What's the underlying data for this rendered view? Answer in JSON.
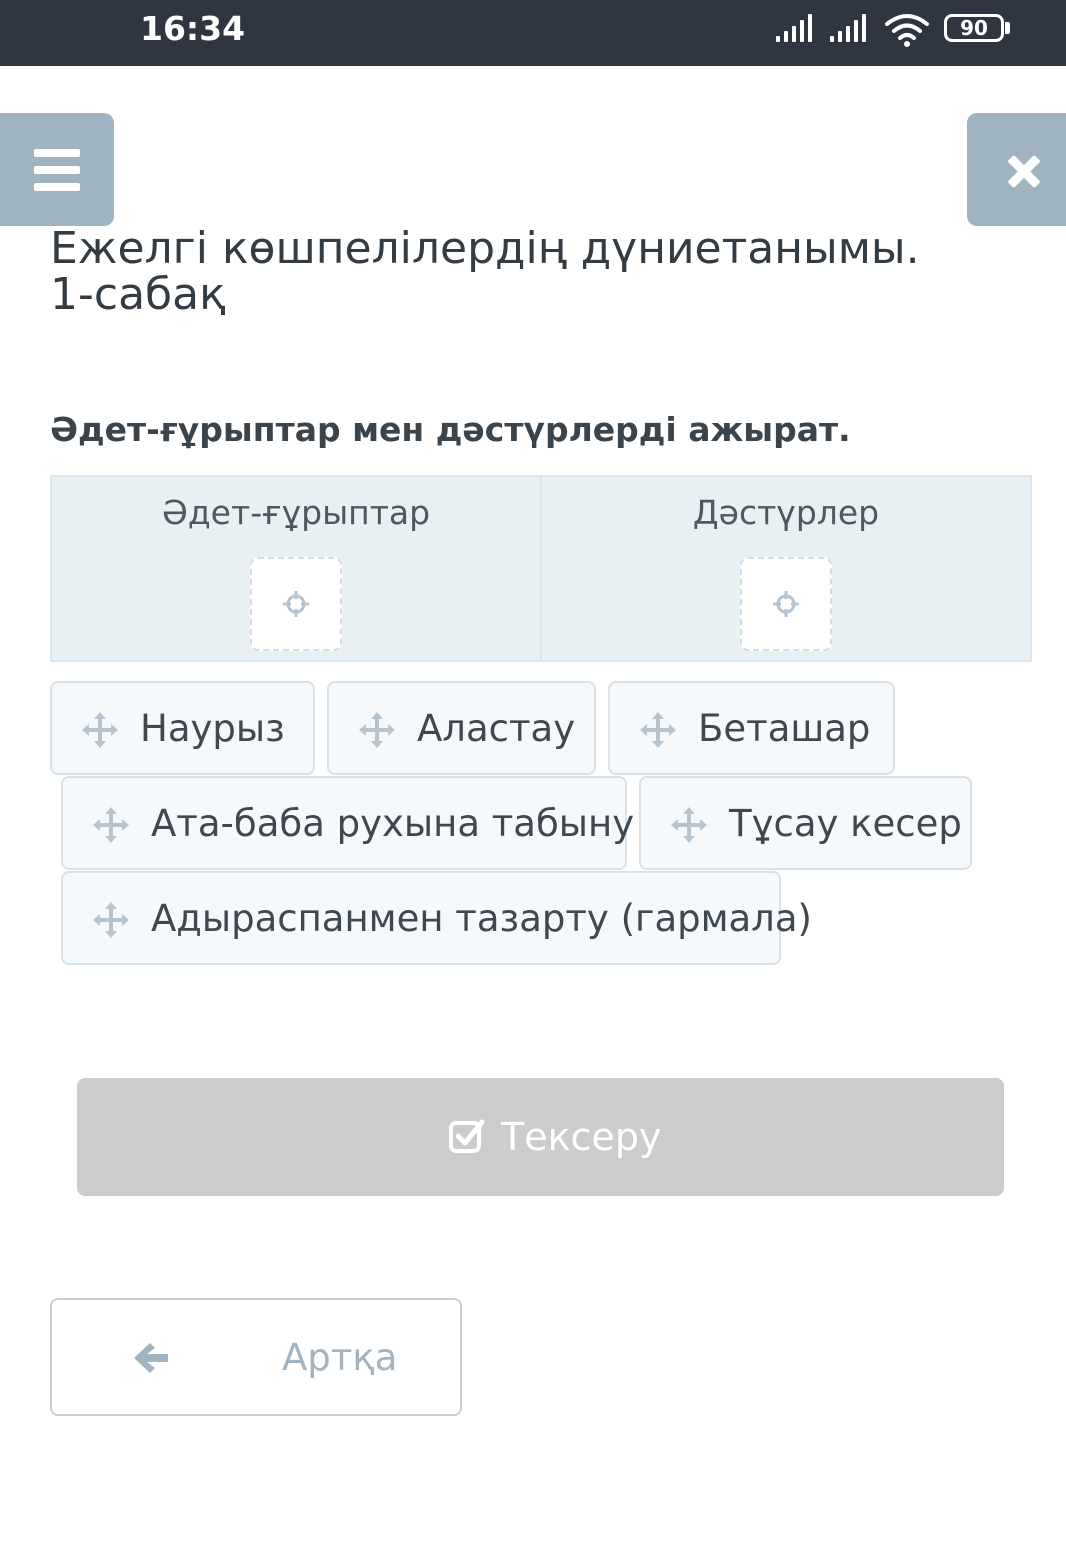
{
  "status_bar": {
    "time": "16:34",
    "battery": "90"
  },
  "header": {
    "title": "Ежелгі көшпелілердің дүниетанымы. 1-сабақ"
  },
  "question": {
    "text": "Әдет-ғұрыптар мен дәстүрлерді ажырат."
  },
  "drop_zones": [
    {
      "label": "Әдет-ғұрыптар"
    },
    {
      "label": "Дәстүрлер"
    }
  ],
  "chips": [
    {
      "text": "Наурыз"
    },
    {
      "text": "Аластау"
    },
    {
      "text": "Беташар"
    },
    {
      "text": "Ата-баба рухына табыну"
    },
    {
      "text": "Тұсау кесер"
    },
    {
      "text": "Адыраспанмен тазарту (гармала)"
    }
  ],
  "check_button": {
    "label": "Тексеру",
    "state": "disabled"
  },
  "back_button": {
    "label": "Артқа"
  },
  "colors": {
    "status_bar": "#2f3541",
    "side_button": "#9fb3c1",
    "zone_background": "#e9f0f4",
    "chip_background": "#f5f9fc",
    "check_button_disabled": "#cccccc"
  },
  "icons": {
    "menu": "hamburger-icon",
    "close": "close-icon",
    "drop_target": "crosshair-icon",
    "chip": "move-icon",
    "check": "checkbox-check-icon",
    "back": "arrow-left-icon"
  }
}
